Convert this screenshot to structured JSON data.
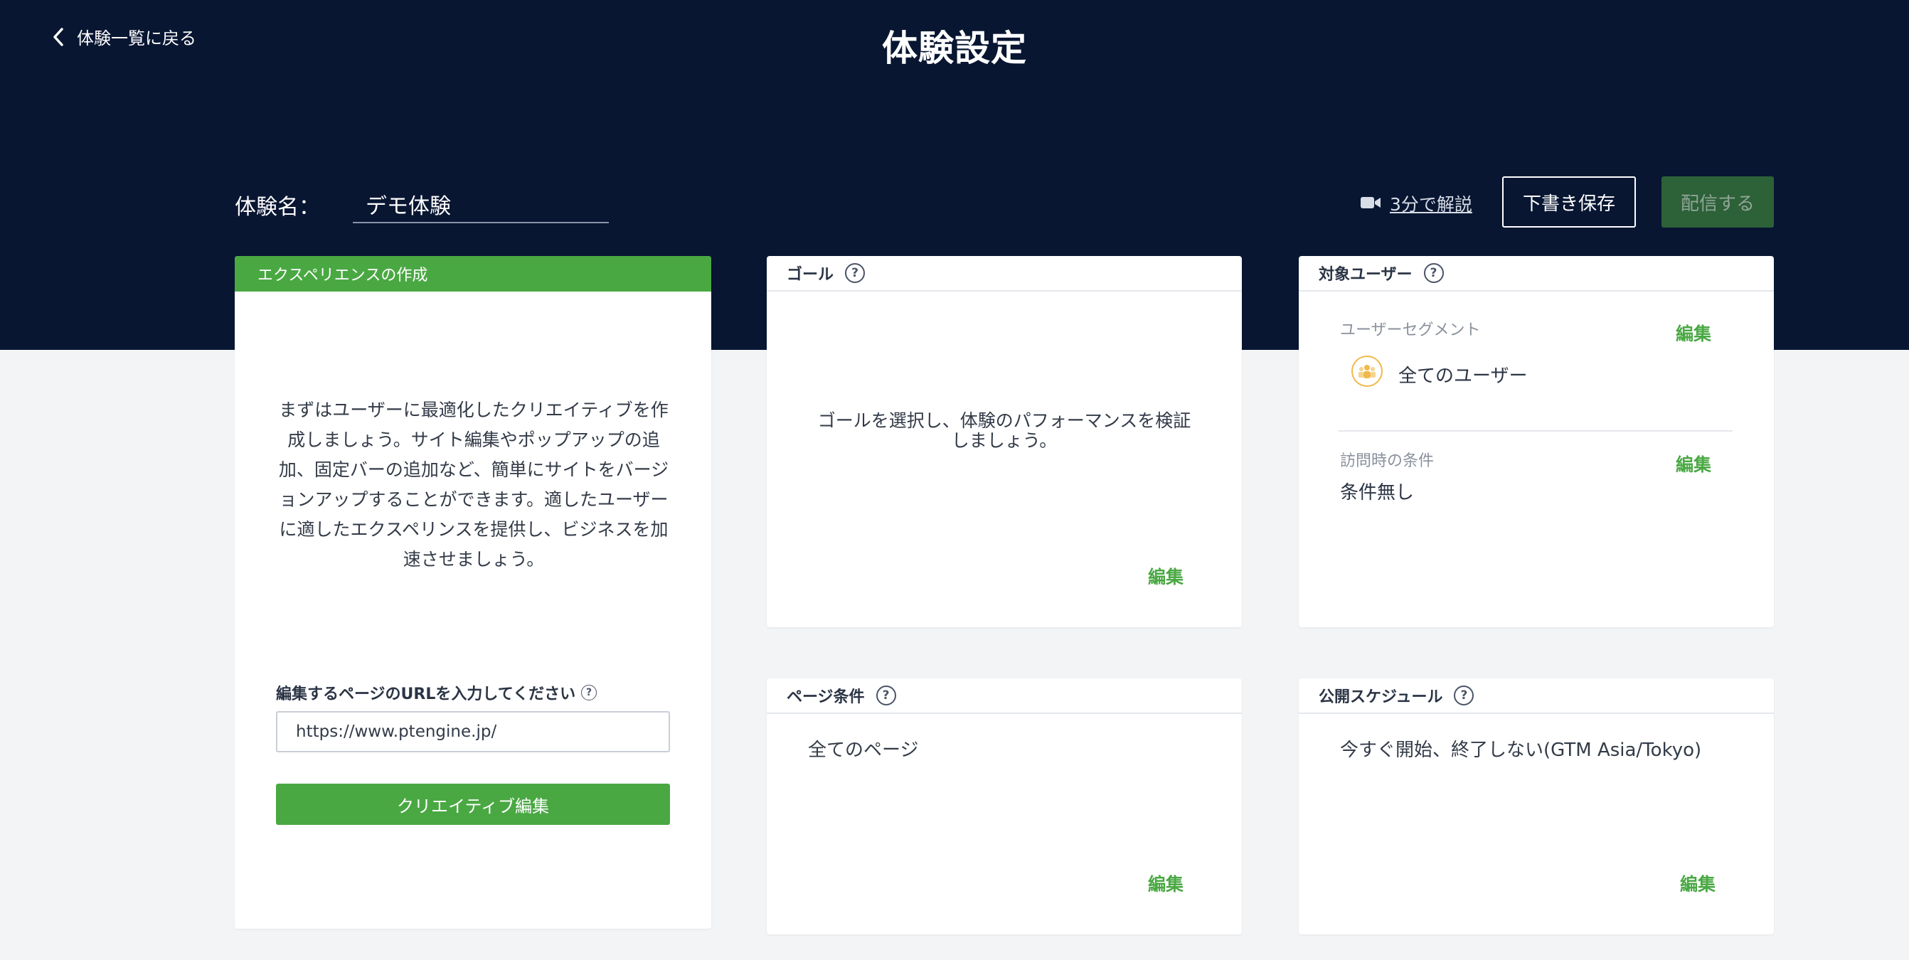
{
  "header": {
    "back_label": "体験一覧に戻る",
    "title": "体験設定",
    "name_label": "体験名：",
    "name_value": "デモ体験",
    "video_link": "3分で解説",
    "draft_button": "下書き保存",
    "publish_button": "配信する"
  },
  "creation_card": {
    "header": "エクスペリエンスの作成",
    "intro": "まずはユーザーに最適化したクリエイティブを作成しましょう。サイト編集やポップアップの追加、固定バーの追加など、簡単にサイトをバージョンアップすることができます。適したユーザーに適したエクスペリンスを提供し、ビジネスを加速させましょう。",
    "url_label": "編集するページのURLを入力してください",
    "url_value": "https://www.ptengine.jp/",
    "creative_button": "クリエイティブ編集"
  },
  "goal_card": {
    "header": "ゴール",
    "text": "ゴールを選択し、体験のパフォーマンスを検証しましょう。",
    "edit": "編集"
  },
  "target_card": {
    "header": "対象ユーザー",
    "segment_label": "ユーザーセグメント",
    "segment_value": "全てのユーザー",
    "segment_edit": "編集",
    "visit_label": "訪問時の条件",
    "visit_value": "条件無し",
    "visit_edit": "編集"
  },
  "page_card": {
    "header": "ページ条件",
    "value": "全てのページ",
    "edit": "編集"
  },
  "schedule_card": {
    "header": "公開スケジュール",
    "value": "今すぐ開始、終了しない(GTM Asia/Tokyo)",
    "edit": "編集"
  },
  "colors": {
    "header_bg": "#081632",
    "accent_green": "#4aa843",
    "publish_disabled": "#2d6138",
    "page_bg": "#f3f4f6"
  },
  "icons": [
    "chevron-left-icon",
    "video-camera-icon",
    "help-icon",
    "users-icon"
  ]
}
